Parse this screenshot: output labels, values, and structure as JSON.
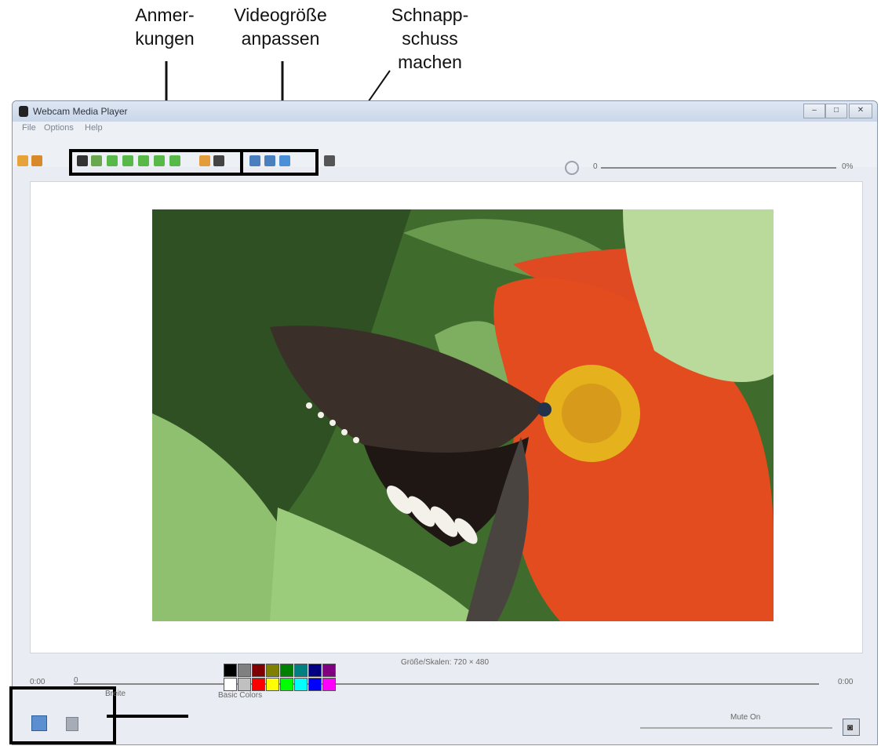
{
  "annotations": [
    {
      "line1": "Anmer-",
      "line2": "kungen"
    },
    {
      "line1": "Videogröße",
      "line2": "anpassen"
    },
    {
      "line1": "Schnapp-",
      "line2": "schuss",
      "line3": "machen"
    }
  ],
  "window": {
    "title": "Webcam Media Player",
    "controls": {
      "minimize": "–",
      "maximize": "□",
      "close": "✕"
    }
  },
  "menu": [
    "File",
    "Options",
    "Help"
  ],
  "toolbar": {
    "file_icons": [
      {
        "name": "open-folder-icon",
        "color": "#e7a23a"
      },
      {
        "name": "open-url-icon",
        "color": "#d9882a"
      }
    ],
    "annotation_tools": [
      {
        "name": "cursor-tool-icon",
        "color": "#333333"
      },
      {
        "name": "text-tool-icon",
        "color": "#6aa84f"
      },
      {
        "name": "pen-tool-icon",
        "color": "#58b848"
      },
      {
        "name": "line-tool-icon",
        "color": "#58b848"
      },
      {
        "name": "arrow-tool-icon",
        "color": "#58b848"
      },
      {
        "name": "rectangle-tool-icon",
        "color": "#58b848"
      },
      {
        "name": "ellipse-tool-icon",
        "color": "#58b848"
      },
      {
        "name": "eraser-tool-icon",
        "color": "#e39b3b"
      },
      {
        "name": "clear-tool-icon",
        "color": "#444444"
      }
    ],
    "resize_tools": [
      {
        "name": "zoom-in-icon",
        "color": "#4a7fbf"
      },
      {
        "name": "zoom-out-icon",
        "color": "#4a7fbf"
      },
      {
        "name": "zoom-fit-icon",
        "color": "#4a90d9"
      }
    ],
    "snapshot_icon": {
      "name": "camera-icon",
      "color": "#555555"
    },
    "zoom_value": "0",
    "zoom_percent": "0%"
  },
  "status": {
    "size_text": "Größe/Skalen: 720 × 480"
  },
  "timeline": {
    "start_time": "0:00",
    "position_marker": "0",
    "end_time": "0:00"
  },
  "bottom": {
    "pen_width_label": "Breite",
    "basic_colors_label": "Basic Colors",
    "mute_label": "Mute On",
    "colors": [
      "#000000",
      "#808080",
      "#800000",
      "#808000",
      "#008000",
      "#008080",
      "#000080",
      "#800080",
      "#ffffff",
      "#c0c0c0",
      "#ff0000",
      "#ffff00",
      "#00ff00",
      "#00ffff",
      "#0000ff",
      "#ff00ff"
    ]
  }
}
